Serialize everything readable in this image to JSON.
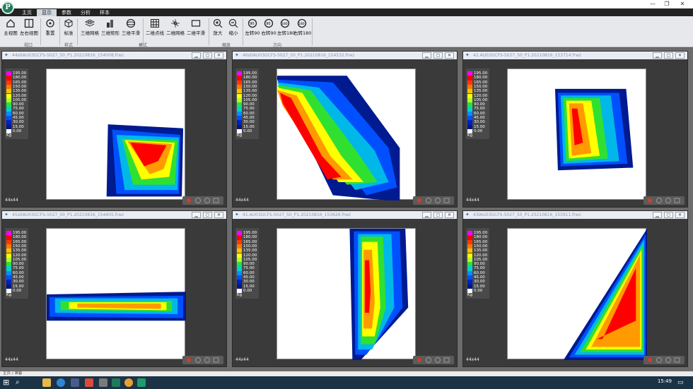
{
  "app": {
    "logo_letter": "P",
    "window_controls": [
      "—",
      "❐",
      "✕"
    ]
  },
  "tabs": [
    {
      "label": "主页",
      "active": false
    },
    {
      "label": "显示",
      "active": true
    },
    {
      "label": "参数",
      "active": false
    },
    {
      "label": "分析",
      "active": false
    },
    {
      "label": "样本",
      "active": false
    }
  ],
  "ribbon": {
    "buttons": {
      "main_view": "主视图",
      "split_view": "左右视图",
      "reset": "重置",
      "standard": "标准",
      "mesh3d": "三维网格",
      "rect3d": "三维矩形",
      "smooth3d": "三维平滑",
      "dots2d": "二维点线",
      "mesh2d": "二维网格",
      "smooth2d": "二维平滑",
      "zoom_in": "放大",
      "zoom_out": "缩小",
      "rot_l90": "左转90",
      "rot_r90": "右转90",
      "rot_l180": "左转180",
      "rot_r180": "右转180"
    },
    "groups": {
      "view": "视口",
      "style": "样式",
      "mode": "模式",
      "zoom": "缩放",
      "dir": "方向"
    }
  },
  "legend": {
    "levels": [
      "195.00",
      "180.00",
      "165.00",
      "150.00",
      "135.00",
      "120.00",
      "105.00",
      "90.00",
      "75.00",
      "60.00",
      "45.00",
      "30.00",
      "15.00",
      "0.00"
    ],
    "colors": [
      "#ff00ff",
      "#ff0000",
      "#ff3a00",
      "#ff7a00",
      "#ffc000",
      "#ffff00",
      "#a8ff30",
      "#30e030",
      "#00d0d0",
      "#0090ff",
      "#0050ff",
      "#0020c0",
      "#001880",
      "#ffffff"
    ],
    "unit": "Kg"
  },
  "panes": [
    {
      "title": "44sltAU03GCFS-5027_50_P1.20210816_154008.frwz",
      "dims": "44x44"
    },
    {
      "title": "46sltAU03GCFS-5027_50_P1.20210816_154532.frwz",
      "dims": "44x44"
    },
    {
      "title": "42.AU03GCFS-5027_50_P1.20210816_153714.frwz",
      "dims": "44x44"
    },
    {
      "title": "45sltAU03GCFS-5027_50_P1.20210816_154405.frwz",
      "dims": "44x44"
    },
    {
      "title": "41.AU03GCFS-5027_50_P1.20210816_153626.frwz",
      "dims": "44x44"
    },
    {
      "title": "43lAU03GCFS-5027_50_P1.20210816_153911.frwz",
      "dims": "44x44"
    }
  ],
  "statusbar": {
    "text": "主页 / 准备"
  },
  "taskbar": {
    "time": "15:49"
  }
}
